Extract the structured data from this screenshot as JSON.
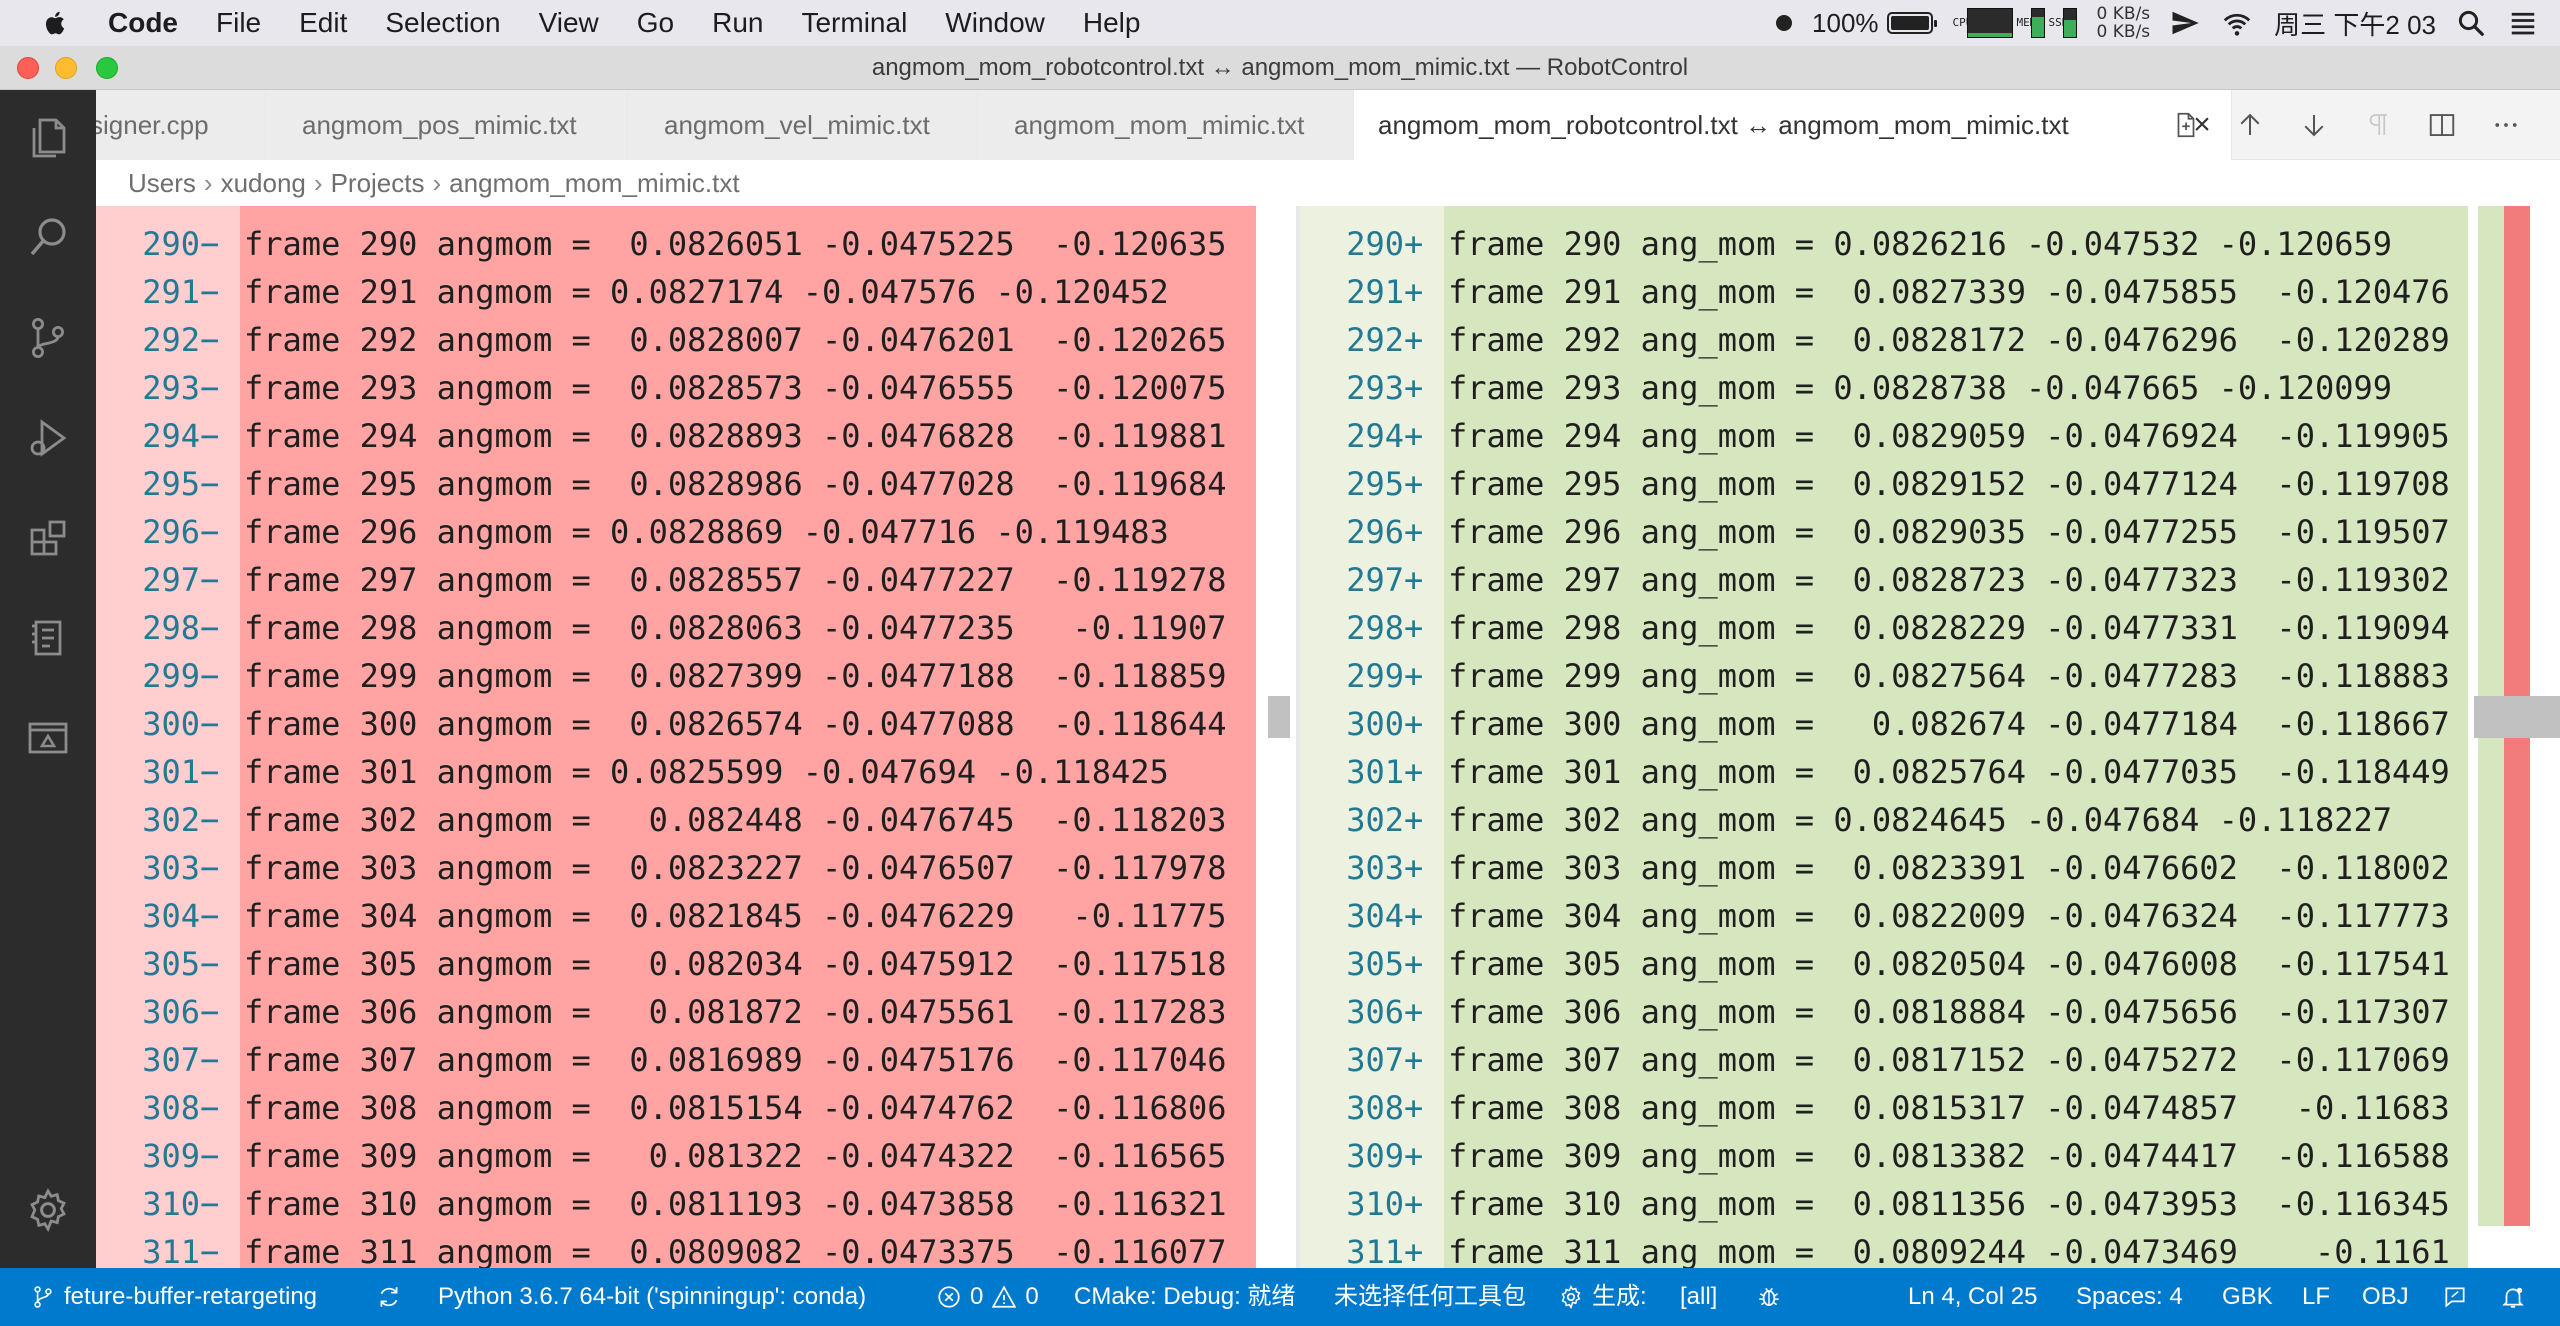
{
  "menubar": {
    "app": "Code",
    "items": [
      "File",
      "Edit",
      "Selection",
      "View",
      "Go",
      "Run",
      "Terminal",
      "Window",
      "Help"
    ],
    "battery_percent": "100%",
    "battery_level": 1.0,
    "cpu_label": "CPU",
    "mem_label": "MEM",
    "ssd_label": "SSD",
    "net_up": "0 KB/s",
    "net_down": "0 KB/s",
    "clock": "周三 下午2 03"
  },
  "window": {
    "title": "angmom_mom_robotcontrol.txt ↔ angmom_mom_mimic.txt — RobotControl"
  },
  "tabs": [
    {
      "label": "signer.cpp"
    },
    {
      "label": "angmom_pos_mimic.txt"
    },
    {
      "label": "angmom_vel_mimic.txt"
    },
    {
      "label": "angmom_mom_mimic.txt"
    },
    {
      "label": "angmom_mom_robotcontrol.txt ↔ angmom_mom_mimic.txt"
    }
  ],
  "breadcrumb": [
    "Users",
    "xudong",
    "Projects",
    "angmom_mom_mimic.txt"
  ],
  "left_editor": {
    "lines": [
      {
        "n": "290",
        "text": "frame 290 angmom =  0.0826051 -0.0475225  -0.120635"
      },
      {
        "n": "291",
        "text": "frame 291 angmom = 0.0827174 -0.047576 -0.120452"
      },
      {
        "n": "292",
        "text": "frame 292 angmom =  0.0828007 -0.0476201  -0.120265"
      },
      {
        "n": "293",
        "text": "frame 293 angmom =  0.0828573 -0.0476555  -0.120075"
      },
      {
        "n": "294",
        "text": "frame 294 angmom =  0.0828893 -0.0476828  -0.119881"
      },
      {
        "n": "295",
        "text": "frame 295 angmom =  0.0828986 -0.0477028  -0.119684"
      },
      {
        "n": "296",
        "text": "frame 296 angmom = 0.0828869 -0.047716 -0.119483"
      },
      {
        "n": "297",
        "text": "frame 297 angmom =  0.0828557 -0.0477227  -0.119278"
      },
      {
        "n": "298",
        "text": "frame 298 angmom =  0.0828063 -0.0477235   -0.11907"
      },
      {
        "n": "299",
        "text": "frame 299 angmom =  0.0827399 -0.0477188  -0.118859"
      },
      {
        "n": "300",
        "text": "frame 300 angmom =  0.0826574 -0.0477088  -0.118644"
      },
      {
        "n": "301",
        "text": "frame 301 angmom = 0.0825599 -0.047694 -0.118425"
      },
      {
        "n": "302",
        "text": "frame 302 angmom =   0.082448 -0.0476745  -0.118203"
      },
      {
        "n": "303",
        "text": "frame 303 angmom =  0.0823227 -0.0476507  -0.117978"
      },
      {
        "n": "304",
        "text": "frame 304 angmom =  0.0821845 -0.0476229   -0.11775"
      },
      {
        "n": "305",
        "text": "frame 305 angmom =   0.082034 -0.0475912  -0.117518"
      },
      {
        "n": "306",
        "text": "frame 306 angmom =   0.081872 -0.0475561  -0.117283"
      },
      {
        "n": "307",
        "text": "frame 307 angmom =  0.0816989 -0.0475176  -0.117046"
      },
      {
        "n": "308",
        "text": "frame 308 angmom =  0.0815154 -0.0474762  -0.116806"
      },
      {
        "n": "309",
        "text": "frame 309 angmom =   0.081322 -0.0474322  -0.116565"
      },
      {
        "n": "310",
        "text": "frame 310 angmom =  0.0811193 -0.0473858  -0.116321"
      },
      {
        "n": "311",
        "text": "frame 311 angmom =  0.0809082 -0.0473375  -0.116077"
      }
    ]
  },
  "right_editor": {
    "lines": [
      {
        "n": "290",
        "text": "frame 290 ang_mom = 0.0826216 -0.047532 -0.120659"
      },
      {
        "n": "291",
        "text": "frame 291 ang_mom =  0.0827339 -0.0475855  -0.120476"
      },
      {
        "n": "292",
        "text": "frame 292 ang_mom =  0.0828172 -0.0476296  -0.120289"
      },
      {
        "n": "293",
        "text": "frame 293 ang_mom = 0.0828738 -0.047665 -0.120099"
      },
      {
        "n": "294",
        "text": "frame 294 ang_mom =  0.0829059 -0.0476924  -0.119905"
      },
      {
        "n": "295",
        "text": "frame 295 ang_mom =  0.0829152 -0.0477124  -0.119708"
      },
      {
        "n": "296",
        "text": "frame 296 ang_mom =  0.0829035 -0.0477255  -0.119507"
      },
      {
        "n": "297",
        "text": "frame 297 ang_mom =  0.0828723 -0.0477323  -0.119302"
      },
      {
        "n": "298",
        "text": "frame 298 ang_mom =  0.0828229 -0.0477331  -0.119094"
      },
      {
        "n": "299",
        "text": "frame 299 ang_mom =  0.0827564 -0.0477283  -0.118883"
      },
      {
        "n": "300",
        "text": "frame 300 ang_mom =   0.082674 -0.0477184  -0.118667"
      },
      {
        "n": "301",
        "text": "frame 301 ang_mom =  0.0825764 -0.0477035  -0.118449"
      },
      {
        "n": "302",
        "text": "frame 302 ang_mom = 0.0824645 -0.047684 -0.118227"
      },
      {
        "n": "303",
        "text": "frame 303 ang_mom =  0.0823391 -0.0476602  -0.118002"
      },
      {
        "n": "304",
        "text": "frame 304 ang_mom =  0.0822009 -0.0476324  -0.117773"
      },
      {
        "n": "305",
        "text": "frame 305 ang_mom =  0.0820504 -0.0476008  -0.117541"
      },
      {
        "n": "306",
        "text": "frame 306 ang_mom =  0.0818884 -0.0475656  -0.117307"
      },
      {
        "n": "307",
        "text": "frame 307 ang_mom =  0.0817152 -0.0475272  -0.117069"
      },
      {
        "n": "308",
        "text": "frame 308 ang_mom =  0.0815317 -0.0474857   -0.11683"
      },
      {
        "n": "309",
        "text": "frame 309 ang_mom =  0.0813382 -0.0474417  -0.116588"
      },
      {
        "n": "310",
        "text": "frame 310 ang_mom =  0.0811356 -0.0473953  -0.116345"
      },
      {
        "n": "311",
        "text": "frame 311 ang_mom =  0.0809244 -0.0473469    -0.1161"
      }
    ]
  },
  "markers": {
    "removed": "−",
    "added": "+"
  },
  "statusbar": {
    "branch": "feture-buffer-retargeting",
    "python": "Python 3.6.7 64-bit ('spinningup': conda)",
    "errors": "0",
    "warnings": "0",
    "cmake": "CMake: Debug: 就绪",
    "kit": "未选择任何工具包",
    "build": "生成:",
    "target": "[all]",
    "position": "Ln 4, Col 25",
    "spaces": "Spaces: 4",
    "encoding": "GBK",
    "eol": "LF",
    "language": "OBJ"
  },
  "colors": {
    "removed_bg": "#ffa3a3",
    "added_bg": "#d6e6bf",
    "statusbar_bg": "#007acc",
    "activitybar_bg": "#2c2c2c"
  }
}
